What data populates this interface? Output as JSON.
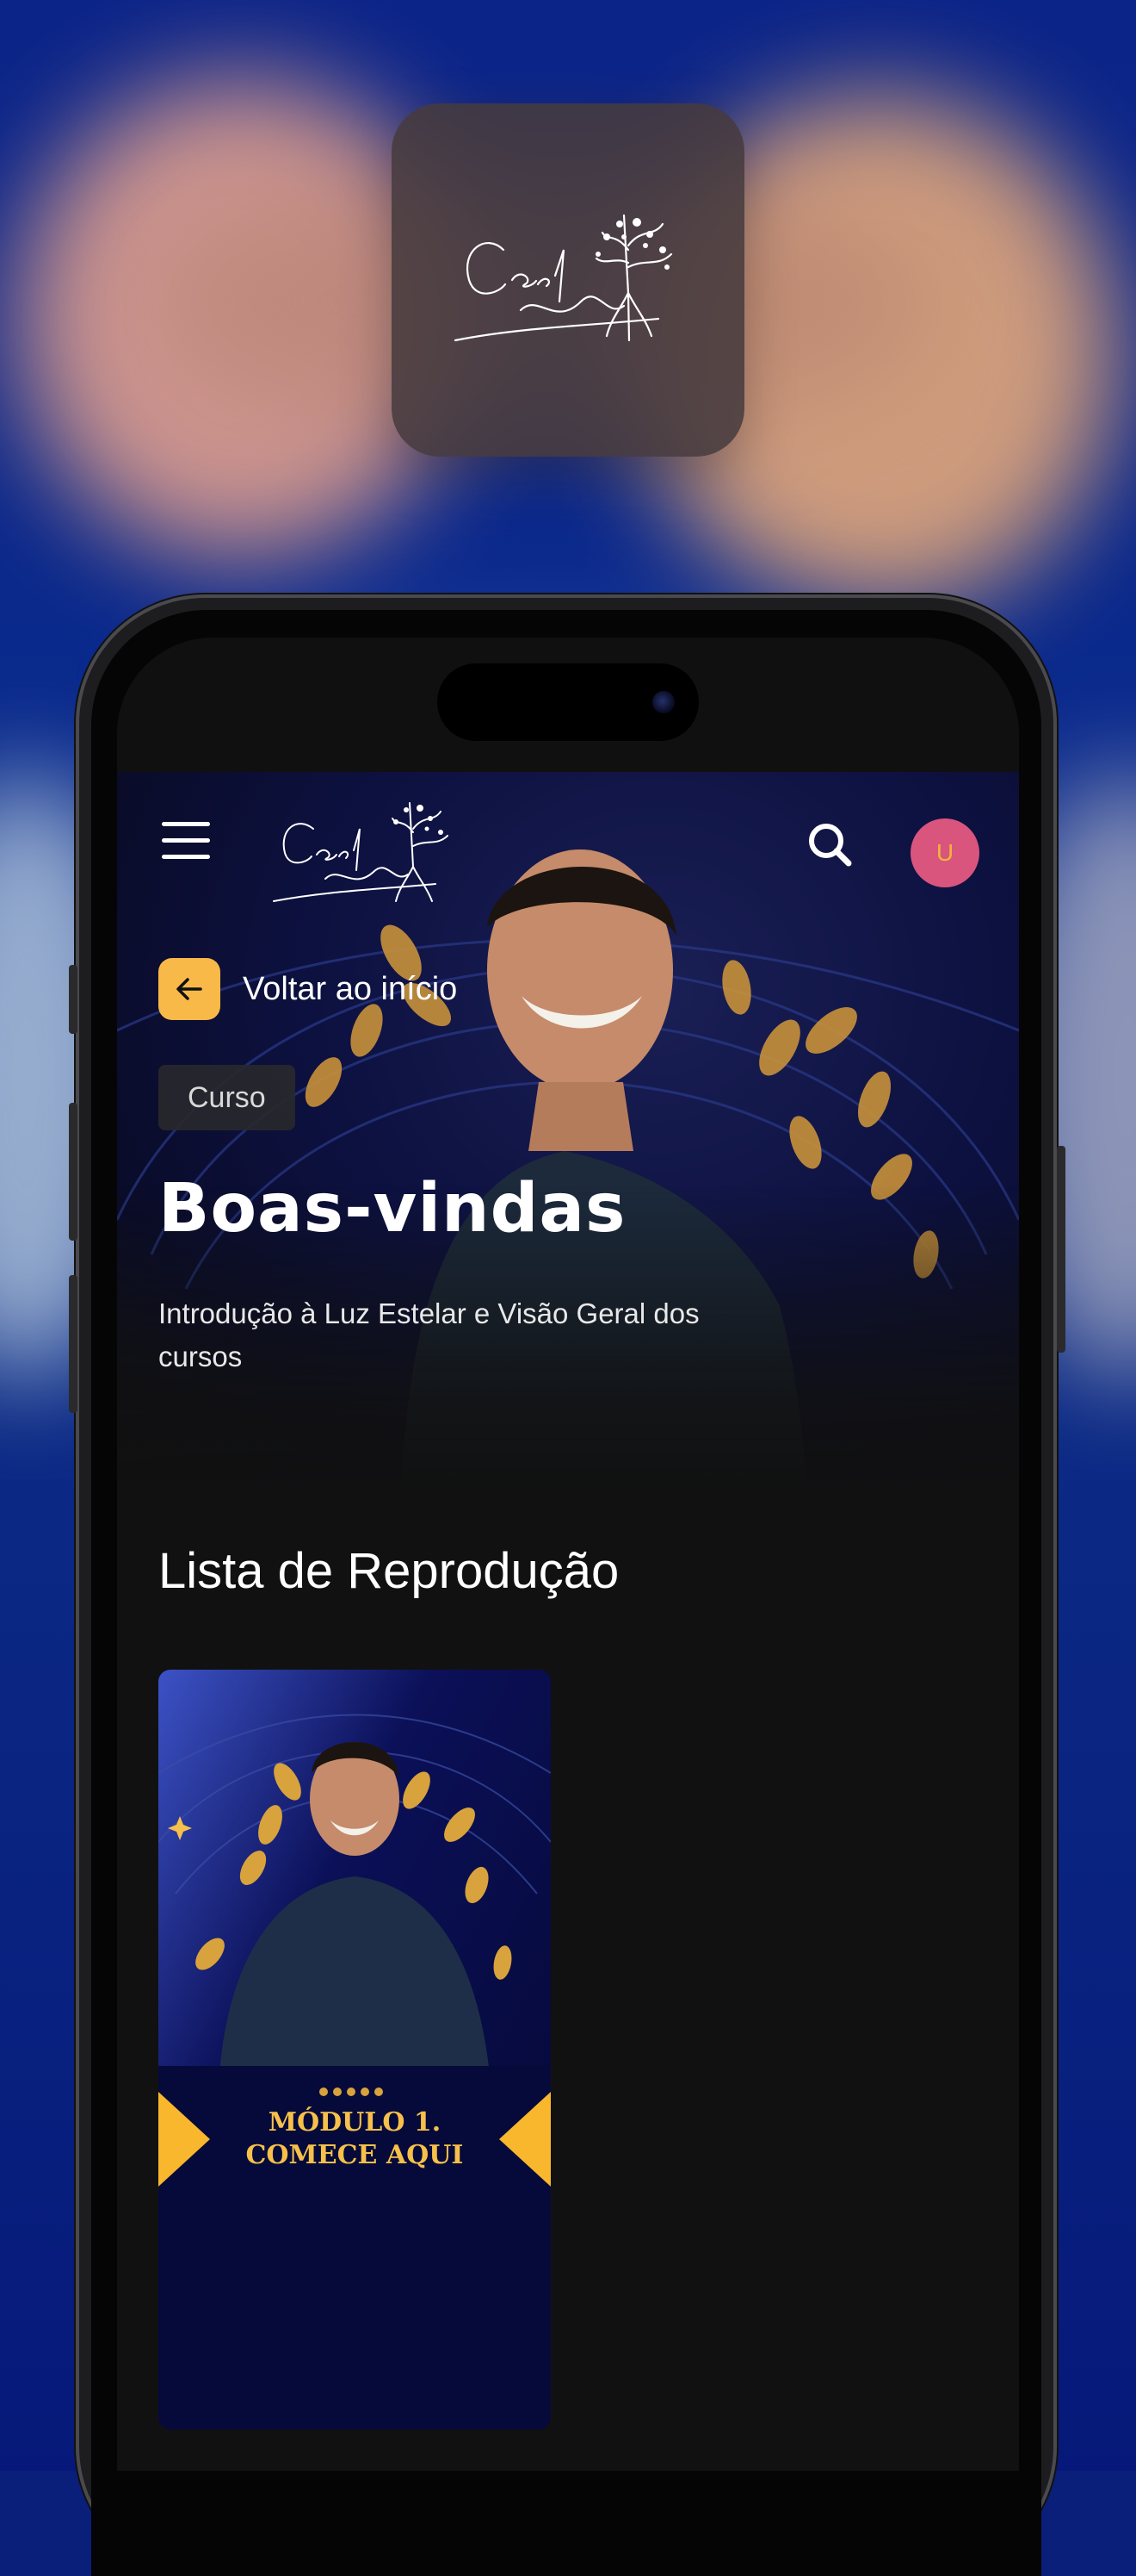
{
  "app_icon": {
    "logo_text": "Cesar Matsumoto"
  },
  "header": {
    "logo_text": "Cesar Matsumoto",
    "menu_icon": "hamburger-menu-icon",
    "search_icon": "search-icon",
    "avatar_initial": "U"
  },
  "hero": {
    "back_label": "Voltar ao início",
    "badge": "Curso",
    "title": "Boas-vindas",
    "subtitle": "Introdução à Luz Estelar e Visão Geral dos cursos"
  },
  "playlist": {
    "title": "Lista de Reprodução",
    "items": [
      {
        "line1": "MÓDULO 1.",
        "line2": "COMECE AQUI"
      }
    ]
  },
  "colors": {
    "accent": "#f8b948",
    "avatar_bg": "#d9557d",
    "screen_bg": "#111111",
    "hero_bg": "#0d1140"
  }
}
